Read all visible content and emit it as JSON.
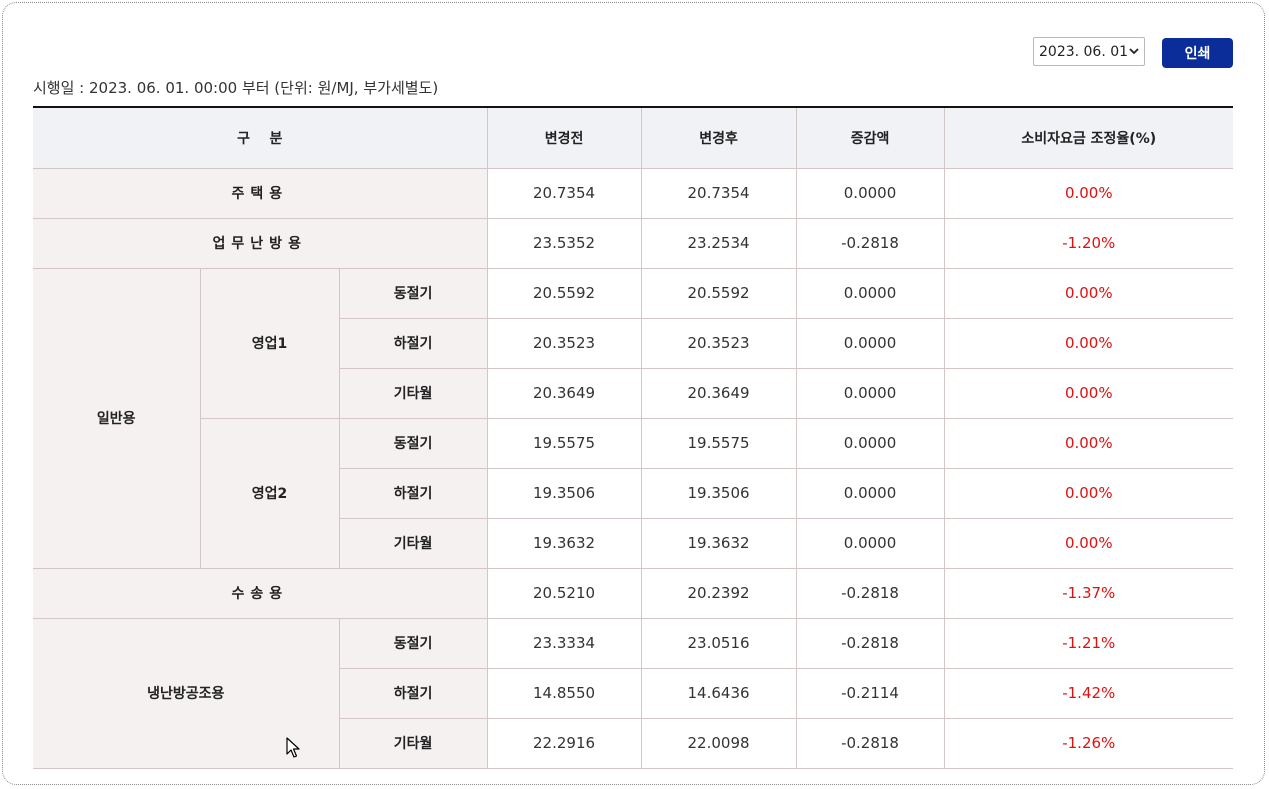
{
  "date_select": {
    "value": "2023. 06. 01"
  },
  "print_button": {
    "label": "인쇄"
  },
  "notice": "시행일 : 2023. 06. 01. 00:00 부터 (단위: 원/MJ, 부가세별도)",
  "headers": {
    "category": "구    분",
    "before": "변경전",
    "after": "변경후",
    "diff": "증감액",
    "rate": "소비자요금 조정율(%)"
  },
  "rows": {
    "residential": {
      "label": "주택용",
      "before": "20.7354",
      "after": "20.7354",
      "diff": "0.0000",
      "rate": "0.00%"
    },
    "office_heating": {
      "label": "업무난방용",
      "before": "23.5352",
      "after": "23.2534",
      "diff": "-0.2818",
      "rate": "-1.20%"
    },
    "general": {
      "label": "일반용",
      "biz1": {
        "label": "영업1",
        "winter": {
          "season": "동절기",
          "before": "20.5592",
          "after": "20.5592",
          "diff": "0.0000",
          "rate": "0.00%"
        },
        "summer": {
          "season": "하절기",
          "before": "20.3523",
          "after": "20.3523",
          "diff": "0.0000",
          "rate": "0.00%"
        },
        "other": {
          "season": "기타월",
          "before": "20.3649",
          "after": "20.3649",
          "diff": "0.0000",
          "rate": "0.00%"
        }
      },
      "biz2": {
        "label": "영업2",
        "winter": {
          "season": "동절기",
          "before": "19.5575",
          "after": "19.5575",
          "diff": "0.0000",
          "rate": "0.00%"
        },
        "summer": {
          "season": "하절기",
          "before": "19.3506",
          "after": "19.3506",
          "diff": "0.0000",
          "rate": "0.00%"
        },
        "other": {
          "season": "기타월",
          "before": "19.3632",
          "after": "19.3632",
          "diff": "0.0000",
          "rate": "0.00%"
        }
      }
    },
    "transport": {
      "label": "수송용",
      "before": "20.5210",
      "after": "20.2392",
      "diff": "-0.2818",
      "rate": "-1.37%"
    },
    "cooling": {
      "label": "냉난방공조용",
      "winter": {
        "season": "동절기",
        "before": "23.3334",
        "after": "23.0516",
        "diff": "-0.2818",
        "rate": "-1.21%"
      },
      "summer": {
        "season": "하절기",
        "before": "14.8550",
        "after": "14.6436",
        "diff": "-0.2114",
        "rate": "-1.42%"
      },
      "other": {
        "season": "기타월",
        "before": "22.2916",
        "after": "22.0098",
        "diff": "-0.2818",
        "rate": "-1.26%"
      }
    }
  },
  "colors": {
    "accent": "#0b2d99",
    "negative": "#e01010",
    "header_bg": "#f0f2f6",
    "category_bg": "#f5f1f1"
  },
  "icons": {
    "select": "chevron-down-icon",
    "cursor": "mouse-pointer-icon"
  }
}
